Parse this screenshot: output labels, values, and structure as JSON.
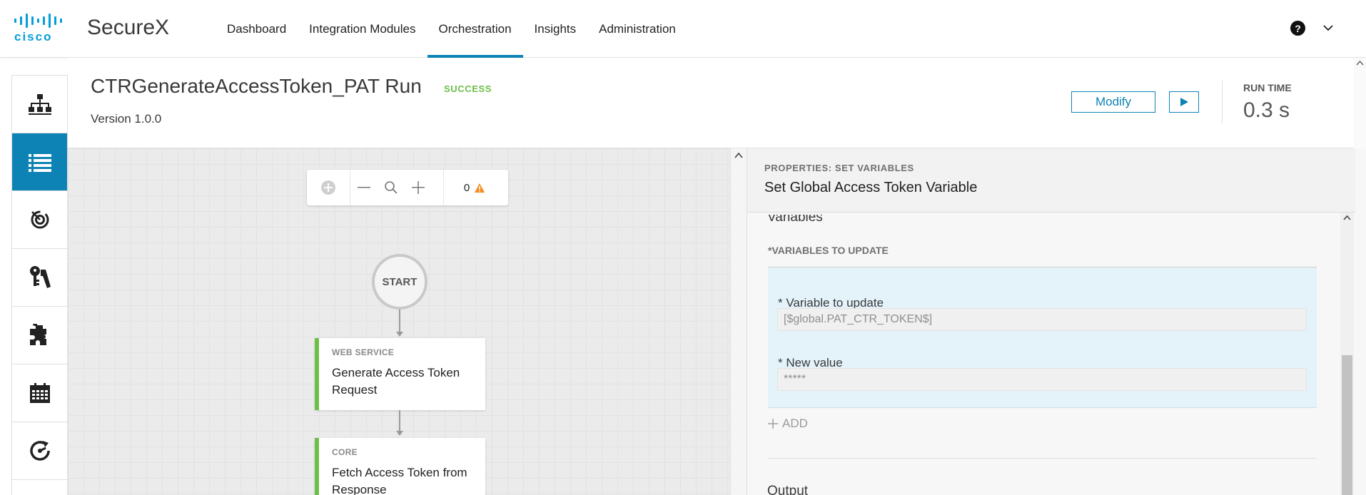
{
  "brand": {
    "logo_text": "cisco",
    "product": "SecureX"
  },
  "nav": {
    "items": [
      {
        "label": "Dashboard"
      },
      {
        "label": "Integration Modules"
      },
      {
        "label": "Orchestration"
      },
      {
        "label": "Insights"
      },
      {
        "label": "Administration"
      }
    ],
    "active": "Orchestration",
    "help_label": "?"
  },
  "sidebar": {
    "items": [
      {
        "icon": "workflows-icon"
      },
      {
        "icon": "runs-list-icon",
        "active": true
      },
      {
        "icon": "targets-icon"
      },
      {
        "icon": "account-keys-icon"
      },
      {
        "icon": "atomic-actions-icon"
      },
      {
        "icon": "calendar-icon"
      },
      {
        "icon": "events-icon"
      }
    ]
  },
  "workflow": {
    "title": "CTRGenerateAccessToken_PAT Run",
    "status": "SUCCESS",
    "version": "Version 1.0.0",
    "modify_label": "Modify",
    "run_time_label": "RUN TIME",
    "run_time_value": "0.3 s"
  },
  "canvas": {
    "warning_count": "0",
    "start_label": "START",
    "activities": [
      {
        "type": "WEB SERVICE",
        "name": "Generate Access Token Request"
      },
      {
        "type": "CORE",
        "name": "Fetch Access Token from Response"
      }
    ]
  },
  "properties": {
    "header_label": "PROPERTIES: SET VARIABLES",
    "title": "Set Global Access Token Variable",
    "section_title": "Variables",
    "vars_label": "*VARIABLES TO UPDATE",
    "variable_label": "* Variable to update",
    "variable_value": "[$global.PAT_CTR_TOKEN$]",
    "new_value_label": "* New value",
    "new_value_value": "*****",
    "add_label": "ADD",
    "output_title": "Output"
  },
  "colors": {
    "accent": "#0d83b5",
    "cisco_blue": "#049fd9",
    "success": "#6cc04a",
    "warning": "#f78b1f"
  }
}
